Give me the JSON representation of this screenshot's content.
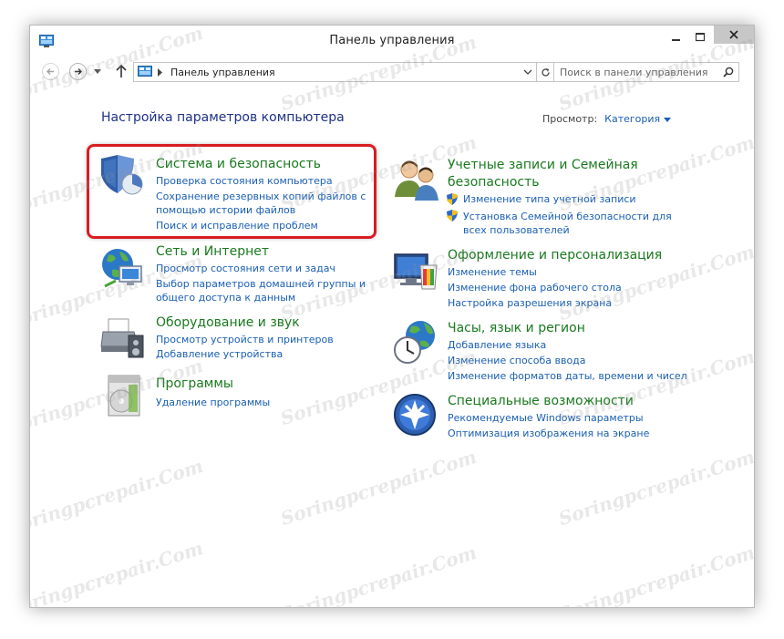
{
  "window": {
    "title": "Панель управления"
  },
  "navbar": {
    "address": "Панель управления",
    "search_placeholder": "Поиск в панели управления"
  },
  "content": {
    "heading": "Настройка параметров компьютера",
    "view_label": "Просмотр:",
    "view_value": "Категория",
    "categories": [
      {
        "title": "Система и безопасность",
        "links": [
          "Проверка состояния компьютера",
          "Сохранение резервных копий файлов с",
          "помощью истории файлов",
          "Поиск и исправление проблем"
        ]
      },
      {
        "title": "Сеть и Интернет",
        "links": [
          "Просмотр состояния сети и задач",
          "Выбор параметров домашней группы и",
          "общего доступа к данным"
        ]
      },
      {
        "title": "Оборудование и звук",
        "links": [
          "Просмотр устройств и принтеров",
          "Добавление устройства"
        ]
      },
      {
        "title": "Программы",
        "links": [
          "Удаление программы"
        ]
      },
      {
        "title_line1": "Учетные записи и Семейная",
        "title_line2": "безопасность",
        "links": [
          "Изменение типа учетной записи",
          "Установка Семейной безопасности для",
          "всех пользователей"
        ]
      },
      {
        "title": "Оформление и персонализация",
        "links": [
          "Изменение темы",
          "Изменение фона рабочего стола",
          "Настройка разрешения экрана"
        ]
      },
      {
        "title": "Часы, язык и регион",
        "links": [
          "Добавление языка",
          "Изменение способа ввода",
          "Изменение форматов даты, времени и чисел"
        ]
      },
      {
        "title": "Специальные возможности",
        "links": [
          "Рекомендуемые Windows параметры",
          "Оптимизация изображения на экране"
        ]
      }
    ]
  },
  "watermark_text": "Soringpcrepair.Com",
  "colors": {
    "heading": "#1e3287",
    "category_title": "#1a7a1f",
    "link": "#1a5fb4",
    "highlight": "#d81d22"
  }
}
